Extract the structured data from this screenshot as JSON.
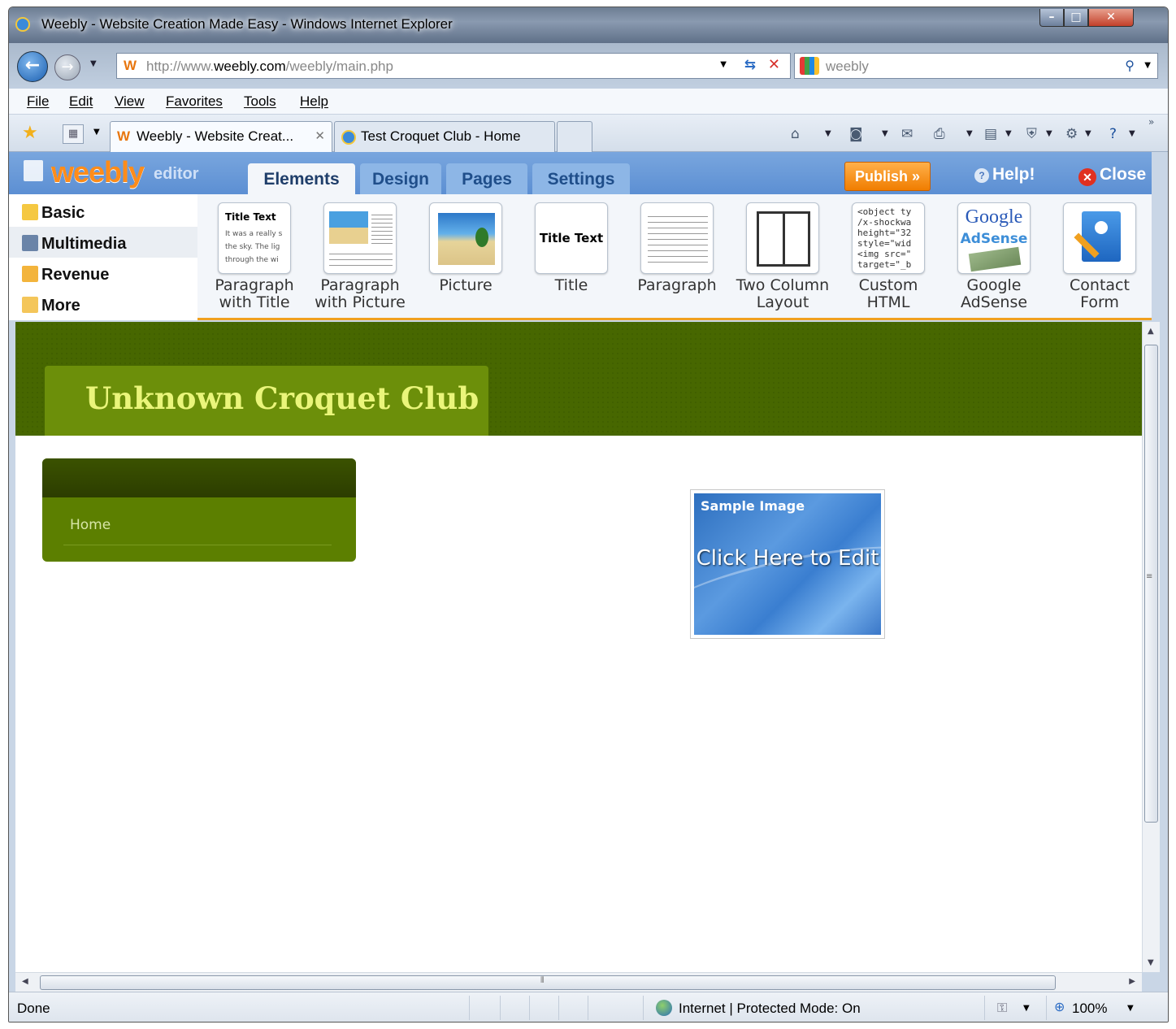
{
  "window": {
    "title": "Weebly - Website Creation Made Easy - Windows Internet Explorer",
    "controls": {
      "minimize": "–",
      "maximize": "□",
      "close": "✕"
    }
  },
  "address_bar": {
    "url_prefix": "http://www.",
    "url_domain": "weebly.com",
    "url_path": "/weebly/main.php",
    "search_value": "weebly"
  },
  "menu": {
    "items": [
      "File",
      "Edit",
      "View",
      "Favorites",
      "Tools",
      "Help"
    ]
  },
  "tabs": {
    "items": [
      {
        "label": "Weebly - Website Creat...",
        "active": true,
        "close": "✕"
      },
      {
        "label": "Test Croquet Club - Home",
        "active": false
      }
    ]
  },
  "weebly": {
    "logo": "weebly",
    "editor_label": "editor",
    "tabs": [
      "Elements",
      "Design",
      "Pages",
      "Settings"
    ],
    "active_tab": "Elements",
    "publish_label": "Publish »",
    "help_label": "Help!",
    "close_label": "Close",
    "categories": [
      "Basic",
      "Multimedia",
      "Revenue",
      "More"
    ],
    "elements": [
      {
        "label": "Paragraph\nwith Title",
        "icon": "paragraph-with-title-thumb",
        "thumb_title": "Title Text",
        "thumb_text": "It was a really s the sky. The lig through the wi"
      },
      {
        "label": "Paragraph\nwith Picture",
        "icon": "paragraph-with-picture-thumb"
      },
      {
        "label": "Picture",
        "icon": "picture-thumb"
      },
      {
        "label": "Title",
        "icon": "title-thumb",
        "thumb_title": "Title Text"
      },
      {
        "label": "Paragraph",
        "icon": "paragraph-thumb"
      },
      {
        "label": "Two Column\nLayout",
        "icon": "two-column-thumb"
      },
      {
        "label": "Custom\nHTML",
        "icon": "custom-html-thumb",
        "thumb_code": "<object ty\n/x-shockwa\nheight=\"32\nstyle=\"wid\n<img src=\"\ntarget=\"_b"
      },
      {
        "label": "Google\nAdSense",
        "icon": "google-adsense-thumb",
        "thumb_google": "Google",
        "thumb_adsense": "AdSense"
      },
      {
        "label": "Contact\nForm",
        "icon": "contact-form-thumb"
      }
    ]
  },
  "page": {
    "site_title": "Unknown Croquet Club",
    "nav_items": [
      "Home"
    ],
    "sample_image_label": "Sample Image",
    "sample_image_cta": "Click Here to Edit"
  },
  "status": {
    "text": "Done",
    "zone": "Internet | Protected Mode: On",
    "zoom": "100%"
  },
  "colors": {
    "header_green": "#476700",
    "title_box_green": "#6c8f0a",
    "title_text": "#eaf57a",
    "weebly_orange": "#ff8c1a",
    "publish_orange": "#f07d00",
    "editor_blue": "#5c8fd3"
  }
}
